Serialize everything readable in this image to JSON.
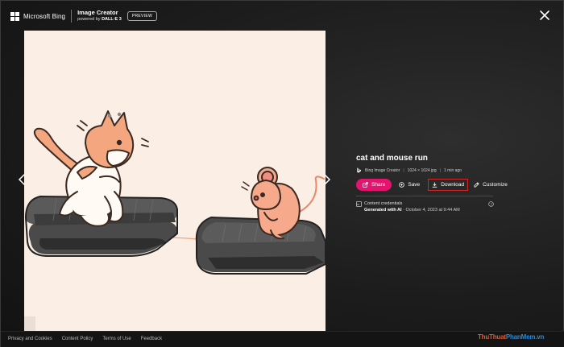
{
  "header": {
    "brand": "Microsoft Bing",
    "app_title": "Image Creator",
    "powered_prefix": "powered by",
    "powered_model": "DALL·E 3",
    "preview_badge": "PREVIEW",
    "close_icon": "close-icon"
  },
  "image": {
    "subject": "cat and mouse running on treadmills",
    "prev_icon": "chevron-left-icon",
    "next_icon": "chevron-right-icon"
  },
  "details": {
    "title": "cat and mouse run",
    "creator": "Bing Image Creator",
    "separator": "|",
    "dimensions": "1024 × 1024 jpg",
    "age": "1 min ago",
    "actions": {
      "share_label": "Share",
      "save_label": "Save",
      "download_label": "Download",
      "customize_label": "Customize"
    },
    "credentials": {
      "heading": "Content credentials",
      "generated_label": "Generated with AI",
      "bullet": "·",
      "date": "October 4, 2023 at 9:44 AM"
    }
  },
  "footer": {
    "links": [
      "Privacy and Cookies",
      "Content Policy",
      "Terms of Use",
      "Feedback"
    ]
  },
  "watermark": {
    "part1": "ThuThuat",
    "part2": "PhanMem.vn"
  },
  "colors": {
    "share_button": "#e3136e",
    "download_highlight": "#d42424",
    "image_background": "#fbeee4"
  }
}
